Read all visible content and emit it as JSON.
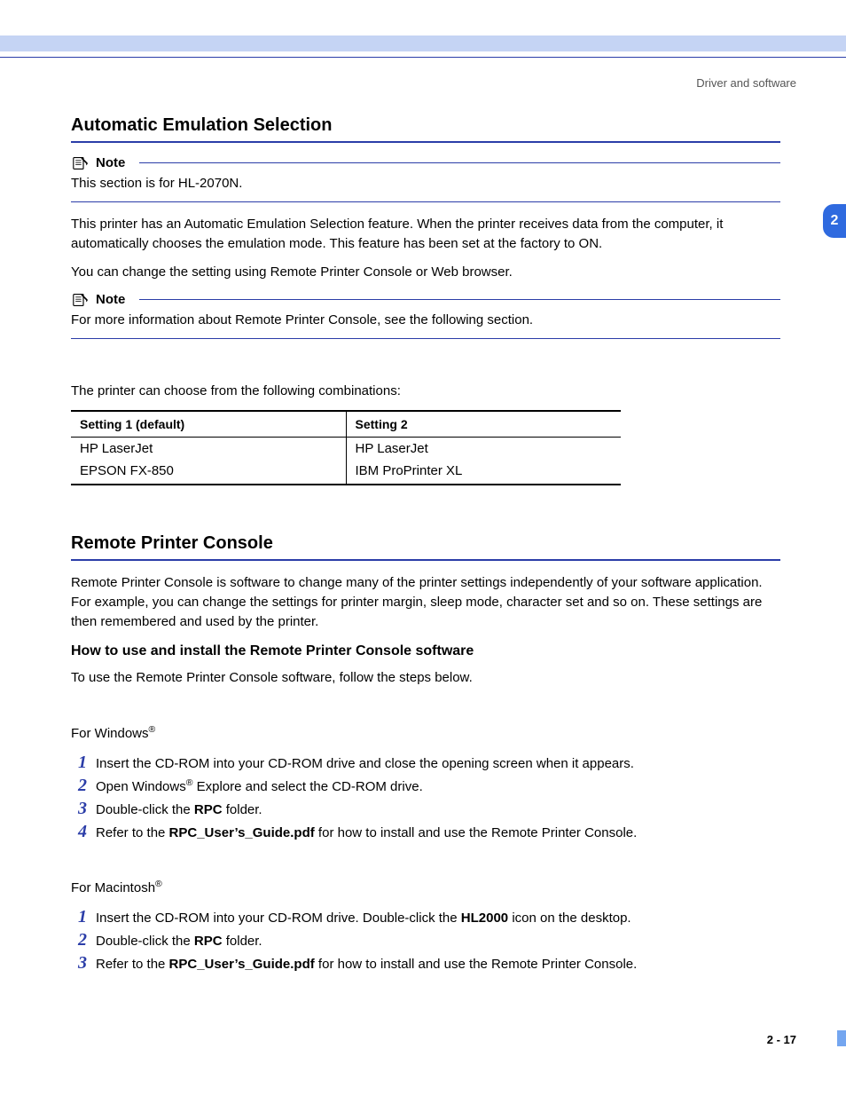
{
  "header": {
    "right": "Driver and software",
    "chapter_tab": "2"
  },
  "section1": {
    "heading": "Automatic Emulation Selection",
    "note1_label": "Note",
    "note1_text": "This section is for HL-2070N.",
    "p1": "This printer has an Automatic Emulation Selection feature. When the printer receives data from the computer, it automatically chooses the emulation mode. This feature has been set at the factory to ON.",
    "p2": "You can change the setting using Remote Printer Console or Web browser.",
    "note2_label": "Note",
    "note2_text": "For more information about Remote Printer Console, see the following section.",
    "p3": "The printer can choose from the following combinations:",
    "table": {
      "head": [
        "Setting 1 (default)",
        "Setting 2"
      ],
      "rows": [
        [
          "HP LaserJet",
          "HP LaserJet"
        ],
        [
          "EPSON FX-850",
          "IBM ProPrinter XL"
        ]
      ]
    }
  },
  "section2": {
    "heading": "Remote Printer Console",
    "p1": "Remote Printer Console is software to change many of the printer settings independently of your software application. For example, you can change the settings for printer margin, sleep mode, character set and so on. These settings are then remembered and used by the printer.",
    "sub": "How to use and install the Remote Printer Console software",
    "p2": "To use the Remote Printer Console software, follow the steps below.",
    "win_label_pre": "For Windows",
    "win_sup": "®",
    "win_steps": [
      {
        "n": "1",
        "t": "Insert the CD-ROM into your CD-ROM drive and close the opening screen when it appears."
      },
      {
        "n": "2",
        "t_pre": "Open Windows",
        "t_sup": "®",
        "t_post": " Explore and select the CD-ROM drive."
      },
      {
        "n": "3",
        "t_pre": "Double-click the ",
        "t_b": "RPC",
        "t_post": " folder."
      },
      {
        "n": "4",
        "t_pre": "Refer to the ",
        "t_b": "RPC_User’s_Guide.pdf",
        "t_post": " for how to install and use the Remote Printer Console."
      }
    ],
    "mac_label_pre": "For Macintosh",
    "mac_sup": "®",
    "mac_steps": [
      {
        "n": "1",
        "t_pre": "Insert the CD-ROM into your CD-ROM drive. Double-click the ",
        "t_b": "HL2000",
        "t_post": " icon on the desktop."
      },
      {
        "n": "2",
        "t_pre": "Double-click the ",
        "t_b": "RPC",
        "t_post": " folder."
      },
      {
        "n": "3",
        "t_pre": "Refer to the ",
        "t_b": "RPC_User’s_Guide.pdf",
        "t_post": " for how to install and use the Remote Printer Console."
      }
    ]
  },
  "footer": {
    "page": "2 - 17"
  }
}
